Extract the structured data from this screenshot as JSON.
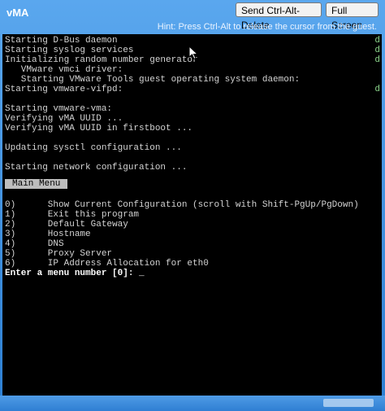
{
  "window": {
    "title": "vMA",
    "buttons": {
      "cad": "Send Ctrl-Alt-Delete",
      "fullscreen": "Full Screen"
    },
    "hint": "Hint: Press Ctrl-Alt to release the cursor from the guest."
  },
  "console": {
    "lines": [
      "Starting D-Bus daemon",
      "Starting syslog services",
      "Initializing random number generator",
      "   VMware vmci driver:",
      "   Starting VMware Tools guest operating system daemon:",
      "Starting vmware-vifpd:",
      "",
      "Starting vmware-vma:",
      "Verifying vMA UUID ...",
      "Verifying vMA UUID in firstboot ...",
      "",
      "Updating sysctl configuration ...",
      "",
      "Starting network configuration ..."
    ],
    "right_marks": [
      "d",
      "d",
      "d",
      "d"
    ],
    "main_menu_label": "Main Menu",
    "menu": [
      "0)      Show Current Configuration (scroll with Shift-PgUp/PgDown)",
      "1)      Exit this program",
      "2)      Default Gateway",
      "3)      Hostname",
      "4)      DNS",
      "5)      Proxy Server",
      "6)      IP Address Allocation for eth0"
    ],
    "prompt": "Enter a menu number [0]: _"
  }
}
